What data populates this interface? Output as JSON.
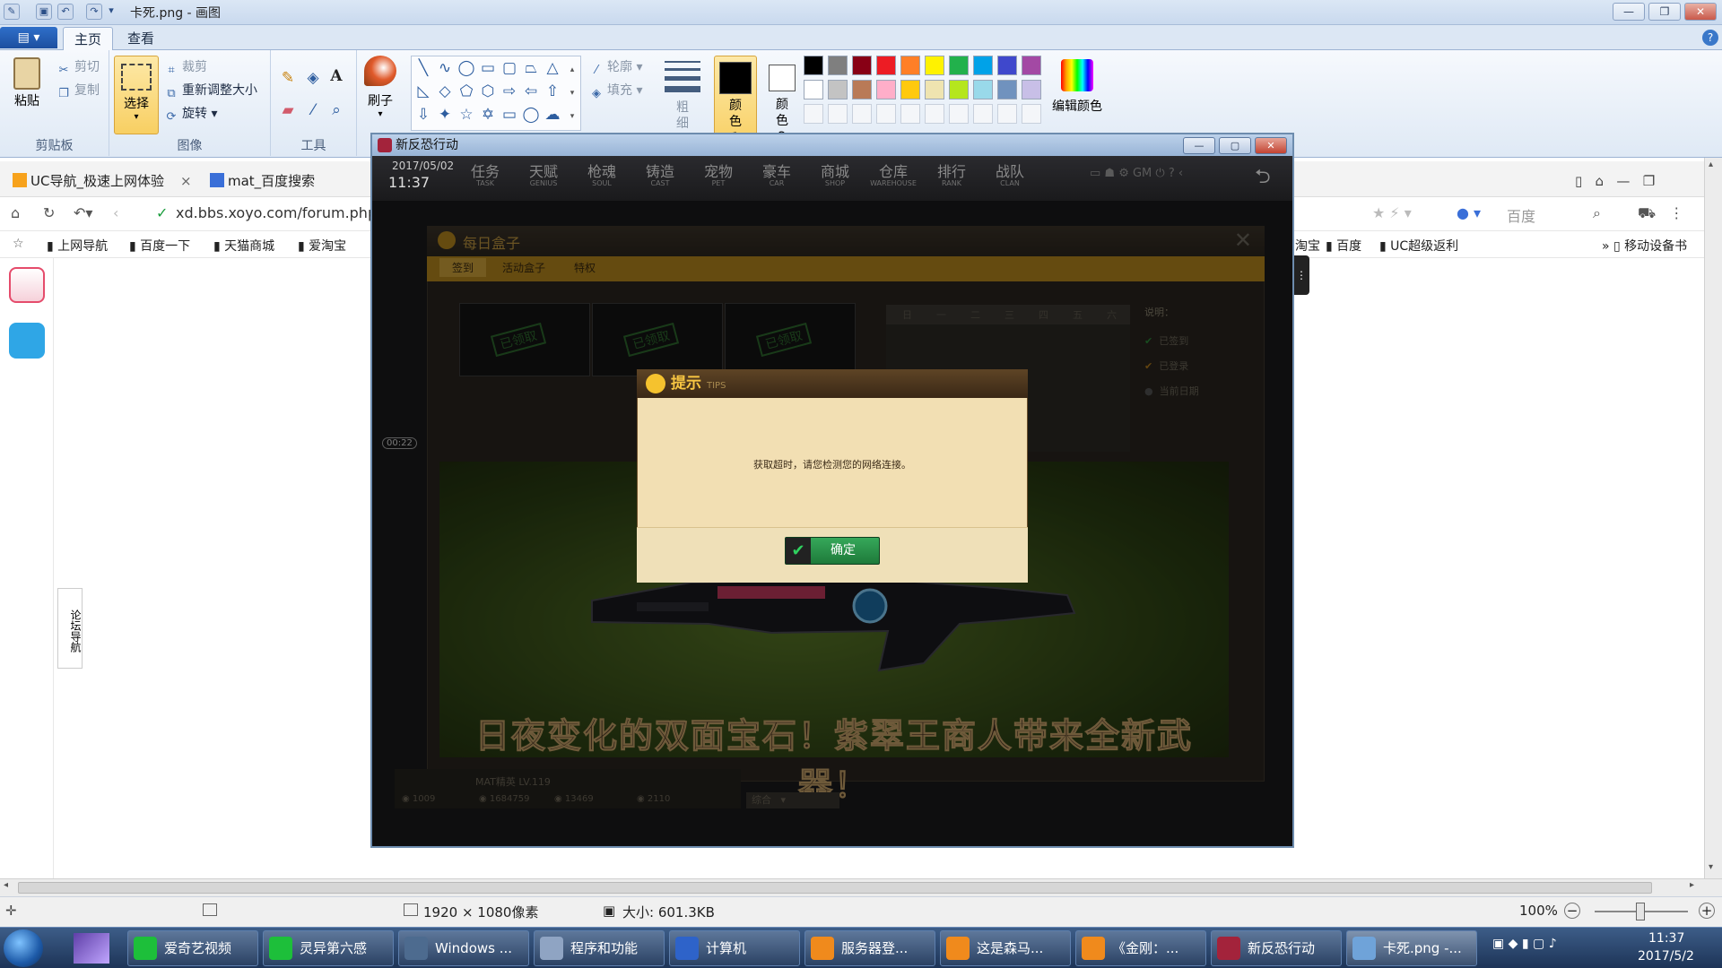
{
  "window": {
    "title": "卡死.png - 画图",
    "minimize": "—",
    "restore": "❐",
    "close": "✕"
  },
  "ribbon": {
    "file_menu": "",
    "tabs": [
      "主页",
      "查看"
    ],
    "clipboard": {
      "paste": "粘贴",
      "cut": "剪切",
      "copy": "复制",
      "label": "剪贴板"
    },
    "image": {
      "select": "选择",
      "crop": "裁剪",
      "resize": "重新调整大小",
      "rotate": "旋转",
      "label": "图像"
    },
    "tools": {
      "label": "工具"
    },
    "brushes": {
      "label": "刷子"
    },
    "shapes": {
      "outline": "轮廓",
      "fill": "填充"
    },
    "size": {
      "label": "粗细"
    },
    "color1": {
      "label": "颜色 1"
    },
    "color2": {
      "label": "颜色 2"
    },
    "edit_colors": "编辑颜色",
    "palette_row1": [
      "#000000",
      "#7f7f7f",
      "#880015",
      "#ed1c24",
      "#ff7f27",
      "#fff200",
      "#22b14c",
      "#00a2e8",
      "#3f48cc",
      "#a349a4"
    ],
    "palette_row2": [
      "#ffffff",
      "#c3c3c3",
      "#b97a57",
      "#ffaec9",
      "#ffc90e",
      "#efe4b0",
      "#b5e61d",
      "#99d9ea",
      "#7092be",
      "#c8bfe7"
    ]
  },
  "browser": {
    "tabs": [
      {
        "label": "UC导航_极速上网体验",
        "close": "×"
      },
      {
        "label": "mat_百度搜索"
      }
    ],
    "address": "xd.bbs.xoyo.com/forum.php?",
    "search_engine": "百度",
    "bookmarks_left": [
      "上网导航",
      "百度一下",
      "天猫商城",
      "爱淘宝"
    ],
    "bookmarks_right": [
      "淘宝",
      "百度",
      "UC超级返利",
      "移动设备书"
    ],
    "side_nav": "论坛导航"
  },
  "game": {
    "window_title": "新反恐行动",
    "date": "2017/05/02",
    "time": "11:37",
    "timer": "00:22",
    "nav": [
      {
        "cn": "任务",
        "en": "TASK"
      },
      {
        "cn": "天赋",
        "en": "GENIUS"
      },
      {
        "cn": "枪魂",
        "en": "SOUL"
      },
      {
        "cn": "铸造",
        "en": "CAST"
      },
      {
        "cn": "宠物",
        "en": "PET"
      },
      {
        "cn": "豪车",
        "en": "CAR"
      },
      {
        "cn": "商城",
        "en": "SHOP"
      },
      {
        "cn": "仓库",
        "en": "WAREHOUSE"
      },
      {
        "cn": "排行",
        "en": "RANK"
      },
      {
        "cn": "战队",
        "en": "CLAN"
      }
    ],
    "panel_title": "每日盒子",
    "panel_tabs": [
      "签到",
      "活动盒子",
      "特权"
    ],
    "weekdays": [
      "日",
      "一",
      "二",
      "三",
      "四",
      "五",
      "六"
    ],
    "legend_title": "说明：",
    "legend": [
      "已签到",
      "已登录",
      "当前日期"
    ],
    "stamp": "已领取",
    "slogan": "日夜变化的双面宝石！紫翠王商人带来全新武器！",
    "player": "MAT精英  LV.119",
    "currency": [
      "1009",
      "1684759",
      "13469",
      "2110"
    ],
    "chat_channel": "综合",
    "dialog": {
      "title": "提示",
      "title_en": "TIPS",
      "message": "获取超时，请您检测您的网络连接。",
      "ok": "确定"
    }
  },
  "status": {
    "dimensions": "1920 × 1080像素",
    "size": "大小: 601.3KB",
    "zoom": "100%"
  },
  "taskbar": {
    "items": [
      "爱奇艺视频",
      "灵异第六感",
      "Windows ...",
      "程序和功能",
      "计算机",
      "服务器登...",
      "这是森马...",
      "《金刚：...",
      "新反恐行动",
      "卡死.png -..."
    ],
    "time": "11:37",
    "date": "2017/5/2"
  }
}
